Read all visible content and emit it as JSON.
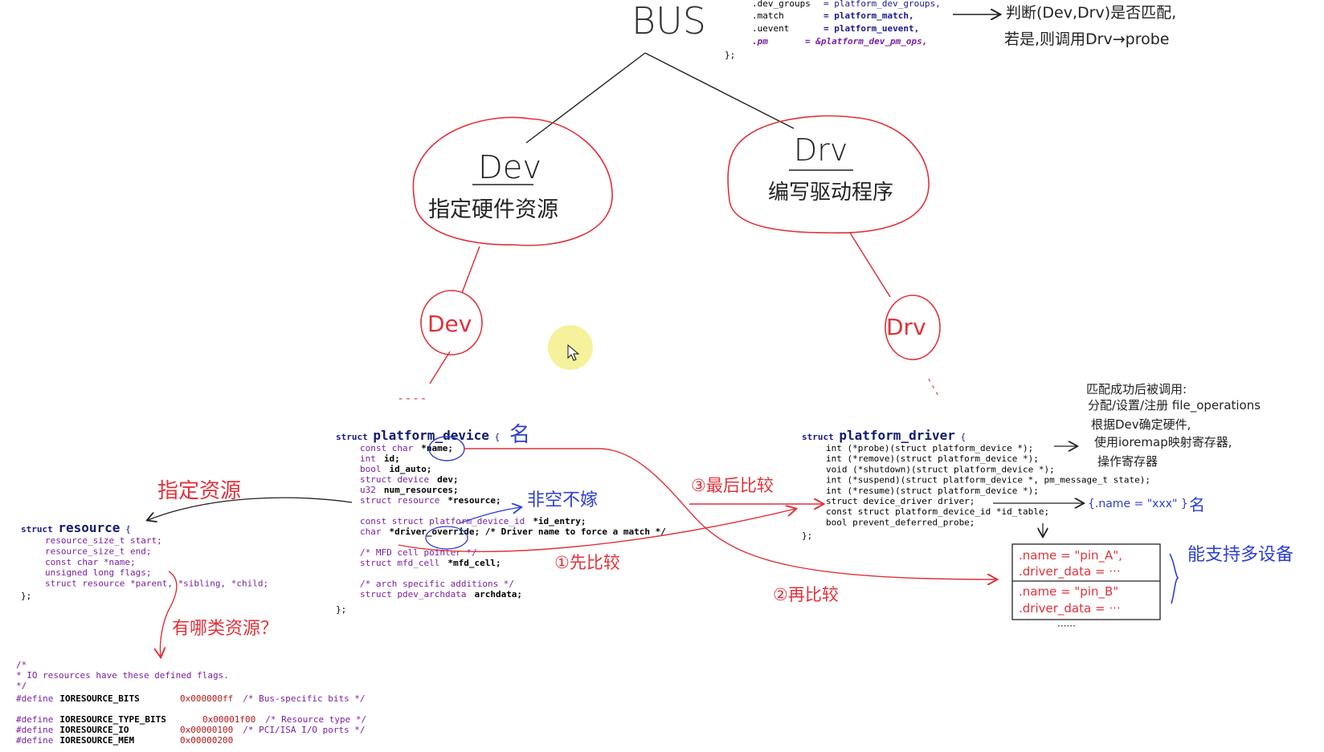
{
  "bus_code": {
    "line1_left": ".dev_groups",
    "line1_right": "= platform_dev_groups,",
    "line2_left": ".match",
    "line2_right": "= platform_match,",
    "line3_left": ".uevent",
    "line3_right": "= platform_uevent,",
    "line4_left": ".pm",
    "line4_right": "= &platform_dev_pm_ops,",
    "line5": "};"
  },
  "notes": {
    "bus": "BUS",
    "match_note_1": "判断(Dev,Drv)是否匹配,",
    "match_note_2": "若是,则调用Drv→probe",
    "dev_circle_title": "Dev",
    "dev_circle_text": "指定硬件资源",
    "drv_circle_title": "Drv",
    "drv_circle_text": "编写驱动程序",
    "dev_small": "Dev",
    "drv_small": "Drv",
    "specify_resource": "指定资源",
    "which_resources": "有哪类资源？",
    "name_mark_dev": "名",
    "name_mark_drv": "名",
    "not_null": "非空不嫁",
    "compare_first": "①先比较",
    "compare_second": "②再比较",
    "compare_last": "③最后比较",
    "multi_device": "能支持多设备",
    "probe_note_1": "匹配成功后被调用:",
    "probe_note_2": "分配/设置/注册 file_operations",
    "probe_note_3": "根据Dev确定硬件,",
    "probe_note_4": "使用ioremap映射寄存器,",
    "probe_note_5": "操作寄存器",
    "name_expr": "{.name = \"xxx\" }",
    "id_table_row1_name": ".name = \"pin_A\",",
    "id_table_row1_data": ".driver_data = ···",
    "id_table_row2_name": ".name = \"pin_B\"",
    "id_table_row2_data": ".driver_data = ···",
    "id_table_more": "······"
  },
  "platform_device": {
    "head_kw": "struct",
    "head_name": "platform_device",
    "head_brace": "{",
    "lines": [
      [
        "const char",
        "*name;"
      ],
      [
        "int",
        "id;"
      ],
      [
        "bool",
        "id_auto;"
      ],
      [
        "struct device",
        "dev;"
      ],
      [
        "u32",
        "num_resources;"
      ],
      [
        "struct resource",
        "*resource;"
      ],
      [
        "const struct platform_device_id",
        "*id_entry;"
      ],
      [
        "char",
        "*driver_override; /* Driver name to force a match */"
      ],
      [
        "/* MFD cell pointer */",
        ""
      ],
      [
        "struct mfd_cell",
        "*mfd_cell;"
      ],
      [
        "/* arch specific additions */",
        ""
      ],
      [
        "struct pdev_archdata",
        "archdata;"
      ]
    ],
    "close": "};"
  },
  "platform_driver": {
    "head_kw": "struct",
    "head_name": "platform_driver",
    "head_brace": "{",
    "lines": [
      "int (*probe)(struct platform_device *);",
      "int (*remove)(struct platform_device *);",
      "void (*shutdown)(struct platform_device *);",
      "int (*suspend)(struct platform_device *, pm_message_t state);",
      "int (*resume)(struct platform_device *);",
      "struct device_driver driver;",
      "const struct platform_device_id *id_table;",
      "bool prevent_deferred_probe;"
    ],
    "close": "};"
  },
  "resource": {
    "head_kw": "struct",
    "head_name": "resource",
    "head_brace": "{",
    "lines": [
      "resource_size_t start;",
      "resource_size_t end;",
      "const char *name;",
      "unsigned long flags;",
      "struct resource *parent, *sibling, *child;"
    ],
    "close": "};"
  },
  "defines": {
    "c1": "/*",
    "c2": " * IO resources have these defined flags.",
    "c3": " */",
    "d1": [
      "#define",
      "IORESOURCE_BITS",
      "0x000000ff",
      "/* Bus-specific bits */"
    ],
    "d2": [
      "#define",
      "IORESOURCE_TYPE_BITS",
      "0x00001f00",
      "/* Resource type */"
    ],
    "d3": [
      "#define",
      "IORESOURCE_IO",
      "0x00000100",
      "/* PCI/ISA I/O ports */"
    ],
    "d4": [
      "#define",
      "IORESOURCE_MEM",
      "0x00000200",
      ""
    ]
  },
  "colors": {
    "red_ink": "#e0323a",
    "blue_ink": "#2d3fd0",
    "black_ink": "#222222",
    "keyword": "#1a1a8c",
    "type": "#7a1fa2",
    "cursor_highlight": "#f4f08a"
  }
}
